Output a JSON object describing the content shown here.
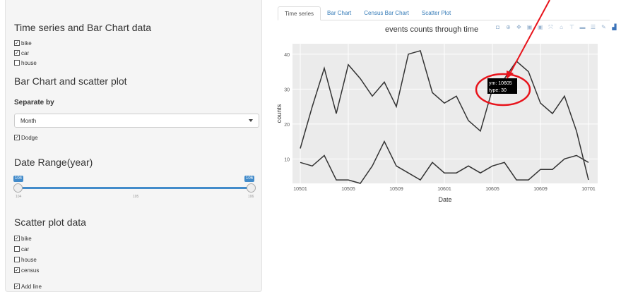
{
  "sidebar": {
    "section1_title": "Time series and Bar Chart data",
    "section1_items": [
      {
        "label": "bike",
        "checked": true
      },
      {
        "label": "car",
        "checked": true
      },
      {
        "label": "house",
        "checked": false
      }
    ],
    "section2_title": "Bar Chart and scatter plot",
    "separate_label": "Separate by",
    "separate_value": "Month",
    "dodge": {
      "label": "Dodge",
      "checked": true
    },
    "date_title": "Date Range(year)",
    "slider": {
      "min_label": "104",
      "max_label": "106",
      "tick_left": "104",
      "tick_mid": "105",
      "tick_right": "106"
    },
    "scatter_title": "Scatter plot data",
    "scatter_items": [
      {
        "label": "bike",
        "checked": true
      },
      {
        "label": "car",
        "checked": false
      },
      {
        "label": "house",
        "checked": false
      },
      {
        "label": "census",
        "checked": true
      }
    ],
    "add_line": {
      "label": "Add line",
      "checked": true
    }
  },
  "tabs": [
    {
      "label": "Time series",
      "active": true
    },
    {
      "label": "Bar Chart",
      "active": false
    },
    {
      "label": "Census Bar Chart",
      "active": false
    },
    {
      "label": "Scatter Plot",
      "active": false
    }
  ],
  "annotation_color": "#e8141c",
  "chart_data": {
    "type": "line",
    "title": "events counts through time",
    "xlabel": "Date",
    "ylabel": "counts",
    "x_tick_labels": [
      "10501",
      "10505",
      "10509",
      "10601",
      "10605",
      "10609",
      "10701"
    ],
    "y_ticks": [
      10,
      20,
      30,
      40
    ],
    "ylim": [
      3,
      43
    ],
    "x_count": 25,
    "grid": true,
    "series": [
      {
        "values": [
          13,
          25,
          36,
          23,
          37,
          33,
          28,
          32,
          25,
          40,
          41,
          29,
          26,
          28,
          21,
          18,
          30,
          33,
          38,
          35,
          26,
          23,
          28,
          18,
          4
        ]
      },
      {
        "values": [
          9,
          8,
          11,
          4,
          4,
          3,
          8,
          15,
          8,
          6,
          4,
          9,
          6,
          6,
          8,
          6,
          8,
          9,
          4,
          4,
          7,
          7,
          10,
          11,
          9,
          4
        ]
      }
    ],
    "tooltip": {
      "line1": "ym: 10605",
      "line2": "type: 30"
    }
  }
}
